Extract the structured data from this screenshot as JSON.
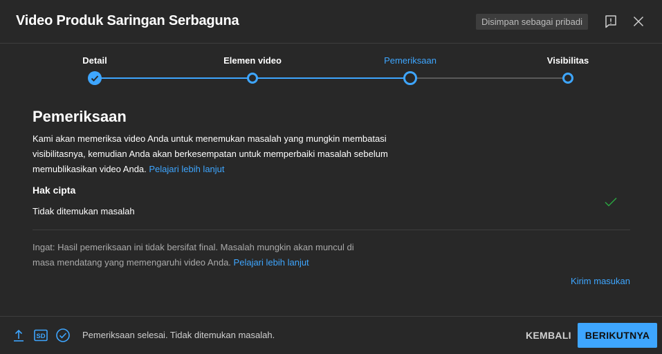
{
  "header": {
    "title": "Video Produk Saringan Serbaguna",
    "saved_badge": "Disimpan sebagai pribadi",
    "feedback_icon": "report-icon",
    "close_icon": "close-icon"
  },
  "stepper": {
    "steps": [
      {
        "label": "Detail",
        "state": "done"
      },
      {
        "label": "Elemen video",
        "state": "done"
      },
      {
        "label": "Pemeriksaan",
        "state": "current"
      },
      {
        "label": "Visibilitas",
        "state": "todo"
      }
    ]
  },
  "main": {
    "title": "Pemeriksaan",
    "description": "Kami akan memeriksa video Anda untuk menemukan masalah yang mungkin membatasi visibilitasnya, kemudian Anda akan berkesempatan untuk memperbaiki masalah sebelum memublikasikan video Anda.",
    "description_link": "Pelajari lebih lanjut",
    "copyright": {
      "heading": "Hak cipta",
      "status": "Tidak ditemukan masalah"
    },
    "note": "Ingat: Hasil pemeriksaan ini tidak bersifat final. Masalah mungkin akan muncul di masa mendatang yang memengaruhi video Anda.",
    "note_link": "Pelajari lebih lanjut",
    "send_feedback": "Kirim masukan"
  },
  "footer": {
    "status": "Pemeriksaan selesai. Tidak ditemukan masalah.",
    "sd_label": "SD",
    "back_label": "KEMBALI",
    "next_label": "BERIKUTNYA"
  },
  "colors": {
    "background": "#282828",
    "accent": "#3ea6ff",
    "success": "#2ba640"
  }
}
